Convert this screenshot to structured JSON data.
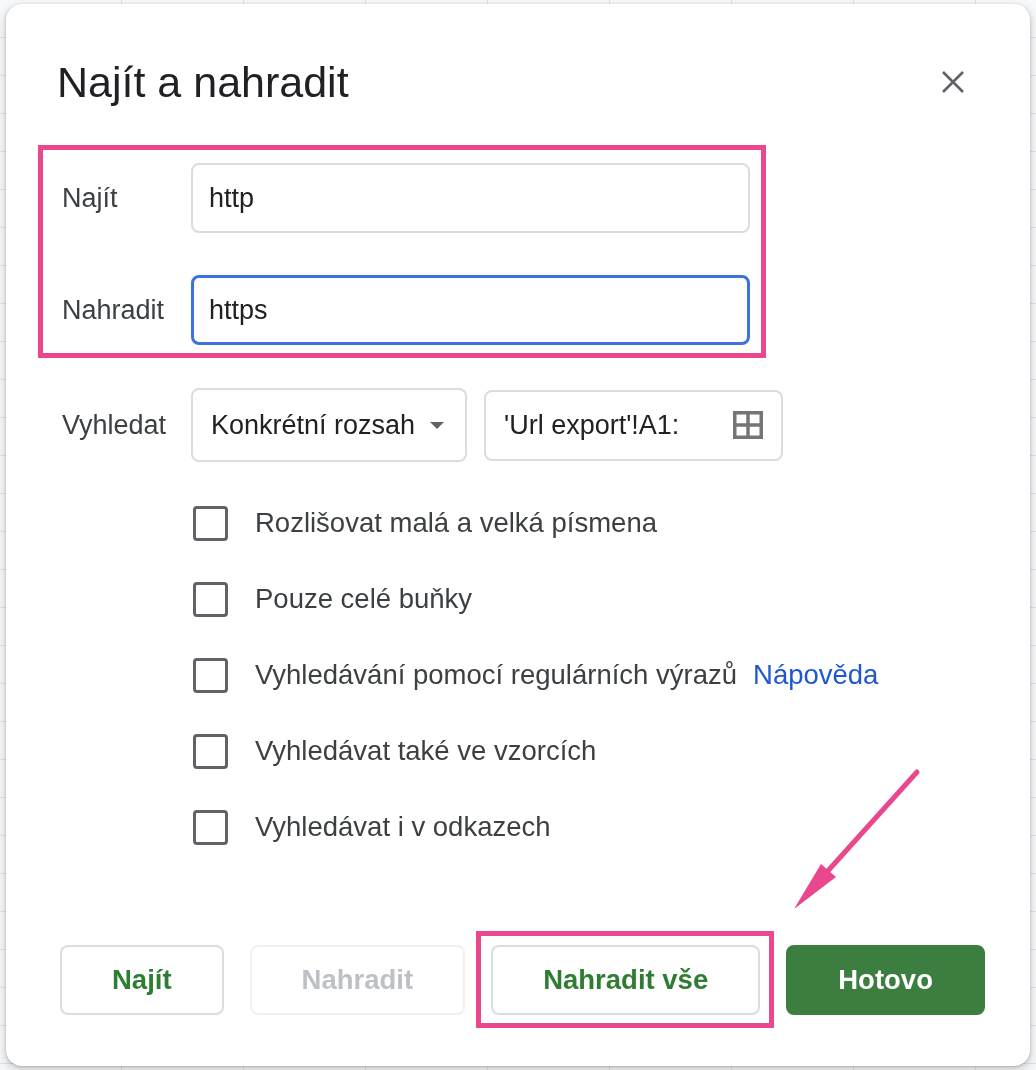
{
  "dialog": {
    "title": "Najít a nahradit",
    "fields": {
      "highlighted": true,
      "items": [
        {
          "label": "Najít",
          "value": "http",
          "focused": false
        },
        {
          "label": "Nahradit",
          "value": "https",
          "focused": true
        }
      ]
    },
    "search_in": {
      "label": "Vyhledat",
      "dropdown": "Konkrétní rozsah",
      "range": "'Url export'!A1:"
    },
    "options": [
      {
        "label": "Rozlišovat malá a velká písmena",
        "checked": false
      },
      {
        "label": "Pouze celé buňky",
        "checked": false
      },
      {
        "label": "Vyhledávání pomocí regulárních výrazů",
        "checked": false,
        "link": "Nápověda"
      },
      {
        "label": "Vyhledávat také ve vzorcích",
        "checked": false
      },
      {
        "label": "Vyhledávat i v odkazech",
        "checked": false
      }
    ],
    "annotation_arrow": true,
    "buttons": [
      {
        "label": "Najít",
        "kind": "outlined",
        "disabled": false,
        "highlighted": false
      },
      {
        "label": "Nahradit",
        "kind": "outlined",
        "disabled": true,
        "highlighted": false
      },
      {
        "label": "Nahradit vše",
        "kind": "outlined",
        "disabled": false,
        "highlighted": true
      },
      {
        "label": "Hotovo",
        "kind": "filled",
        "disabled": false,
        "highlighted": false
      }
    ]
  }
}
